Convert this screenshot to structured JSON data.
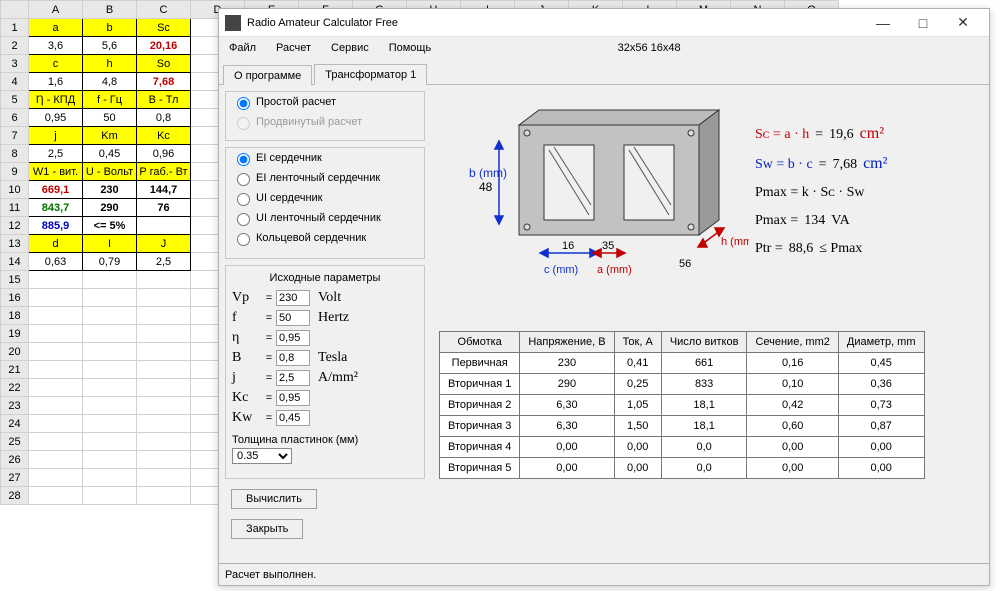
{
  "sheet": {
    "cols": [
      "A",
      "B",
      "C",
      "D",
      "E",
      "F",
      "G",
      "H",
      "I",
      "J",
      "K",
      "L",
      "M",
      "N",
      "O"
    ],
    "rows": [
      {
        "num": "1",
        "a": "a",
        "b": "b",
        "c": "Sc",
        "style": "yellow-header"
      },
      {
        "num": "2",
        "a": "3,6",
        "b": "5,6",
        "c": "20,16",
        "style": "abc-red"
      },
      {
        "num": "3",
        "a": "c",
        "b": "h",
        "c": "So",
        "style": "yellow-header"
      },
      {
        "num": "4",
        "a": "1,6",
        "b": "4,8",
        "c": "7,68",
        "style": "abc-red"
      },
      {
        "num": "5",
        "a": "Ƞ - КПД",
        "b": "f - Гц",
        "c": "В - Тл",
        "style": "yellow-header"
      },
      {
        "num": "6",
        "a": "0,95",
        "b": "50",
        "c": "0,8",
        "style": "plain"
      },
      {
        "num": "7",
        "a": "j",
        "b": "Km",
        "c": "Kc",
        "style": "yellow-header"
      },
      {
        "num": "8",
        "a": "2,5",
        "b": "0,45",
        "c": "0,96",
        "style": "plain"
      },
      {
        "num": "9",
        "a": "W1 - вит.",
        "b": "U - Вольт",
        "c": "P габ.- Вт",
        "style": "yellow-header"
      },
      {
        "num": "10",
        "a": "669,1",
        "b": "230",
        "c": "144,7",
        "style": "r10"
      },
      {
        "num": "11",
        "a": "843,7",
        "b": "290",
        "c": "76",
        "style": "r11"
      },
      {
        "num": "12",
        "a": "885,9",
        "b": "<= 5%",
        "c": "",
        "style": "r12"
      },
      {
        "num": "13",
        "a": "d",
        "b": "I",
        "c": "J",
        "style": "yellow-header"
      },
      {
        "num": "14",
        "a": "0,63",
        "b": "0,79",
        "c": "2,5",
        "style": "plain"
      },
      {
        "num": "15"
      },
      {
        "num": "16"
      },
      {
        "num": "18"
      },
      {
        "num": "19"
      },
      {
        "num": "20"
      },
      {
        "num": "21"
      },
      {
        "num": "22"
      },
      {
        "num": "23"
      },
      {
        "num": "24"
      },
      {
        "num": "25"
      },
      {
        "num": "26"
      },
      {
        "num": "27"
      },
      {
        "num": "28"
      }
    ]
  },
  "dialog": {
    "title": "Radio Amateur Calculator Free",
    "menu": [
      "Файл",
      "Расчет",
      "Сервис",
      "Помощь"
    ],
    "dim_label": "32x56 16x48",
    "tabs": [
      "О программе",
      "Трансформатор 1"
    ],
    "calc_mode": {
      "simple": "Простой расчет",
      "advanced": "Продвинутый расчет"
    },
    "core_types": [
      "EI сердечник",
      "EI ленточный сердечник",
      "UI сердечник",
      "UI ленточный сердечник",
      "Кольцевой сердечник"
    ],
    "params": {
      "header": "Исходные параметры",
      "vp": {
        "label": "Vp",
        "value": "230",
        "unit": "Volt"
      },
      "f": {
        "label": "f",
        "value": "50",
        "unit": "Hertz"
      },
      "eta": {
        "label": "η",
        "value": "0,95",
        "unit": ""
      },
      "b": {
        "label": "B",
        "value": "0,8",
        "unit": "Tesla"
      },
      "j": {
        "label": "j",
        "value": "2,5",
        "unit": "A/mm²"
      },
      "kc": {
        "label": "Kc",
        "value": "0,95",
        "unit": ""
      },
      "kw": {
        "label": "Kw",
        "value": "0,45",
        "unit": ""
      },
      "thick_label": "Толщина пластинок (мм)",
      "thick_value": "0.35"
    },
    "buttons": {
      "calc": "Вычислить",
      "close": "Закрыть"
    },
    "diagram": {
      "b_label": "b (mm)",
      "b_value": "48",
      "c_label": "c (mm)",
      "c_value": "16",
      "a_label": "a (mm)",
      "a_value": "35",
      "h_label": "h (mm)",
      "h_value": "56"
    },
    "formulas": {
      "sc_left": "Sᴄ = a · h",
      "sc_value": "19,6",
      "sc_unit": "cm²",
      "sw_left": "Sᴡ = b · c",
      "sw_value": "7,68",
      "sw_unit": "cm²",
      "pmax1": "Pmax = k · Sᴄ · Sᴡ",
      "pmax2_l": "Pmax =",
      "pmax2_v": "134",
      "pmax2_u": "VA",
      "ptr_l": "Ptr =",
      "ptr_v": "88,6",
      "ptr_r": "≤ Pmax"
    },
    "wtable": {
      "headers": [
        "Обмотка",
        "Напряжение, В",
        "Ток, А",
        "Число витков",
        "Сечение, mm2",
        "Диаметр, mm"
      ],
      "rows": [
        [
          "Первичная",
          "230",
          "0,41",
          "661",
          "0,16",
          "0,45"
        ],
        [
          "Вторичная 1",
          "290",
          "0,25",
          "833",
          "0,10",
          "0,36"
        ],
        [
          "Вторичная 2",
          "6,30",
          "1,05",
          "18,1",
          "0,42",
          "0,73"
        ],
        [
          "Вторичная 3",
          "6,30",
          "1,50",
          "18,1",
          "0,60",
          "0,87"
        ],
        [
          "Вторичная 4",
          "0,00",
          "0,00",
          "0,0",
          "0,00",
          "0,00"
        ],
        [
          "Вторичная 5",
          "0,00",
          "0,00",
          "0,0",
          "0,00",
          "0,00"
        ]
      ]
    },
    "status": "Расчет выполнен."
  }
}
